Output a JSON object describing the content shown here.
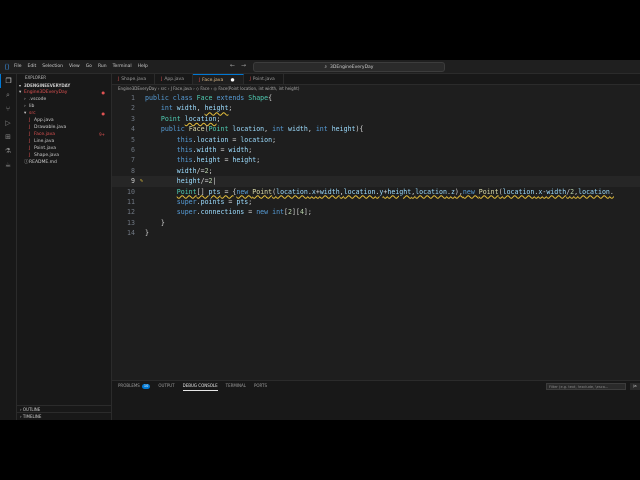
{
  "titlebar": {
    "menu": [
      "File",
      "Edit",
      "Selection",
      "View",
      "Go",
      "Run",
      "Terminal",
      "Help"
    ],
    "command_center": "3DEngineEveryDay"
  },
  "sidebar": {
    "header": "EXPLORER",
    "project": "3DENGINEEVERYDAY",
    "items": [
      {
        "label": "Engine3DEveryDay",
        "ic": "▾",
        "indent": 2,
        "color": "#e05252",
        "badge": "●"
      },
      {
        "label": ".vscode",
        "ic": "›",
        "indent": 7,
        "color": "#cccccc",
        "badge": ""
      },
      {
        "label": "lib",
        "ic": "›",
        "indent": 7,
        "color": "#cccccc",
        "badge": ""
      },
      {
        "label": "src",
        "ic": "▾",
        "indent": 7,
        "color": "#e05252",
        "badge": "●"
      },
      {
        "label": "App.java",
        "ic": "J",
        "indent": 12,
        "color": "#cccccc",
        "badge": ""
      },
      {
        "label": "Drawable.java",
        "ic": "J",
        "indent": 12,
        "color": "#cccccc",
        "badge": ""
      },
      {
        "label": "Face.java",
        "ic": "J",
        "indent": 12,
        "color": "#e05252",
        "badge": "9+"
      },
      {
        "label": "Line.java",
        "ic": "J",
        "indent": 12,
        "color": "#cccccc",
        "badge": ""
      },
      {
        "label": "Point.java",
        "ic": "J",
        "indent": 12,
        "color": "#cccccc",
        "badge": ""
      },
      {
        "label": "Shape.java",
        "ic": "J",
        "indent": 12,
        "color": "#cccccc",
        "badge": ""
      },
      {
        "label": "README.md",
        "ic": "ⓘ",
        "indent": 7,
        "color": "#cccccc",
        "badge": ""
      }
    ],
    "outline": "OUTLINE",
    "timeline": "TIMELINE"
  },
  "tabs": [
    {
      "label": "Shape.java",
      "active": false
    },
    {
      "label": "App.java",
      "active": false
    },
    {
      "label": "Face.java",
      "active": true
    },
    {
      "label": "Point.java",
      "active": false
    }
  ],
  "breadcrumb": "Engine3DEveryDay  ›  src  ›  J Face.java  ›  ◇ Face  ›  ◎ Face(Point location, int width, int height)",
  "code": [
    [
      [
        "kw",
        "public "
      ],
      [
        "kw",
        "class "
      ],
      [
        "ty",
        "Face "
      ],
      [
        "kw",
        "extends "
      ],
      [
        "ty",
        "Shape"
      ],
      [
        "",
        "{"
      ]
    ],
    [
      [
        "",
        "    "
      ],
      [
        "kw",
        "int "
      ],
      [
        "fld",
        "width"
      ],
      [
        "",
        ", "
      ],
      [
        "fld",
        "height"
      ],
      [
        "",
        ";"
      ]
    ],
    [
      [
        "",
        "    "
      ],
      [
        "ty",
        "Point "
      ],
      [
        "fld",
        "location"
      ],
      [
        "",
        ";"
      ]
    ],
    [
      [
        "",
        "    "
      ],
      [
        "kw",
        "public "
      ],
      [
        "fn",
        "Face"
      ],
      [
        "",
        "("
      ],
      [
        "ty",
        "Point "
      ],
      [
        "fld",
        "location"
      ],
      [
        "",
        ", "
      ],
      [
        "kw",
        "int "
      ],
      [
        "fld",
        "width"
      ],
      [
        "",
        ", "
      ],
      [
        "kw",
        "int "
      ],
      [
        "fld",
        "height"
      ],
      [
        "",
        ")"
      ],
      [
        "",
        "{"
      ]
    ],
    [
      [
        "",
        "        "
      ],
      [
        "kw",
        "this"
      ],
      [
        "",
        "."
      ],
      [
        "fld",
        "location"
      ],
      [
        "",
        " = "
      ],
      [
        "fld",
        "location"
      ],
      [
        "",
        ";"
      ]
    ],
    [
      [
        "",
        "        "
      ],
      [
        "kw",
        "this"
      ],
      [
        "",
        "."
      ],
      [
        "fld",
        "width"
      ],
      [
        "",
        " = "
      ],
      [
        "fld",
        "width"
      ],
      [
        "",
        ";"
      ]
    ],
    [
      [
        "",
        "        "
      ],
      [
        "kw",
        "this"
      ],
      [
        "",
        "."
      ],
      [
        "fld",
        "height"
      ],
      [
        "",
        " = "
      ],
      [
        "fld",
        "height"
      ],
      [
        "",
        ";"
      ]
    ],
    [
      [
        "",
        "        "
      ],
      [
        "fld",
        "width"
      ],
      [
        "",
        "/="
      ],
      [
        "nm",
        "2"
      ],
      [
        "",
        ";"
      ]
    ],
    [
      [
        "",
        "        "
      ],
      [
        "fld",
        "height"
      ],
      [
        "",
        "/="
      ],
      [
        "nm",
        "2"
      ],
      [
        "",
        "|"
      ]
    ],
    [
      [
        "",
        "        "
      ],
      [
        "ty",
        "Point"
      ],
      [
        "",
        "[] "
      ],
      [
        "fld",
        "pts"
      ],
      [
        "",
        " = {"
      ],
      [
        "kw",
        "new "
      ],
      [
        "fn",
        "Point"
      ],
      [
        "",
        "("
      ],
      [
        "fld",
        "location"
      ],
      [
        "",
        "."
      ],
      [
        "fld",
        "x"
      ],
      [
        "",
        "+"
      ],
      [
        "fld",
        "width"
      ],
      [
        "",
        ","
      ],
      [
        "fld",
        "location"
      ],
      [
        "",
        "."
      ],
      [
        "fld",
        "y"
      ],
      [
        "",
        "+"
      ],
      [
        "fld",
        "height"
      ],
      [
        "",
        ","
      ],
      [
        "fld",
        "location"
      ],
      [
        "",
        "."
      ],
      [
        "fld",
        "z"
      ],
      [
        "",
        "),"
      ],
      [
        "kw",
        "new "
      ],
      [
        "fn",
        "Point"
      ],
      [
        "",
        "("
      ],
      [
        "fld",
        "location"
      ],
      [
        "",
        "."
      ],
      [
        "fld",
        "x"
      ],
      [
        "",
        "-"
      ],
      [
        "fld",
        "width"
      ],
      [
        "",
        "/"
      ],
      [
        "nm",
        "2"
      ],
      [
        "",
        ","
      ],
      [
        "fld",
        "location"
      ],
      [
        "",
        "."
      ]
    ],
    [
      [
        "",
        "        "
      ],
      [
        "kw",
        "super"
      ],
      [
        "",
        "."
      ],
      [
        "fld",
        "points"
      ],
      [
        "",
        " = "
      ],
      [
        "fld",
        "pts"
      ],
      [
        "",
        ";"
      ]
    ],
    [
      [
        "",
        "        "
      ],
      [
        "kw",
        "super"
      ],
      [
        "",
        "."
      ],
      [
        "fld",
        "connections"
      ],
      [
        "",
        " = "
      ],
      [
        "kw",
        "new "
      ],
      [
        "kw",
        "int"
      ],
      [
        "",
        "["
      ],
      [
        "nm",
        "2"
      ],
      [
        "",
        "]["
      ],
      [
        "nm",
        "4"
      ],
      [
        "",
        "];"
      ]
    ],
    [
      [
        "",
        "    "
      ],
      [
        "",
        "}"
      ]
    ],
    [
      [
        "",
        "}"
      ]
    ]
  ],
  "panel": {
    "tabs": [
      "PROBLEMS",
      "OUTPUT",
      "DEBUG CONSOLE",
      "TERMINAL",
      "PORTS"
    ],
    "problems_count": "10",
    "filter_placeholder": "Filter (e.g. text, !exclude, \\esca...",
    "active_tab": "DEBUG CONSOLE"
  }
}
